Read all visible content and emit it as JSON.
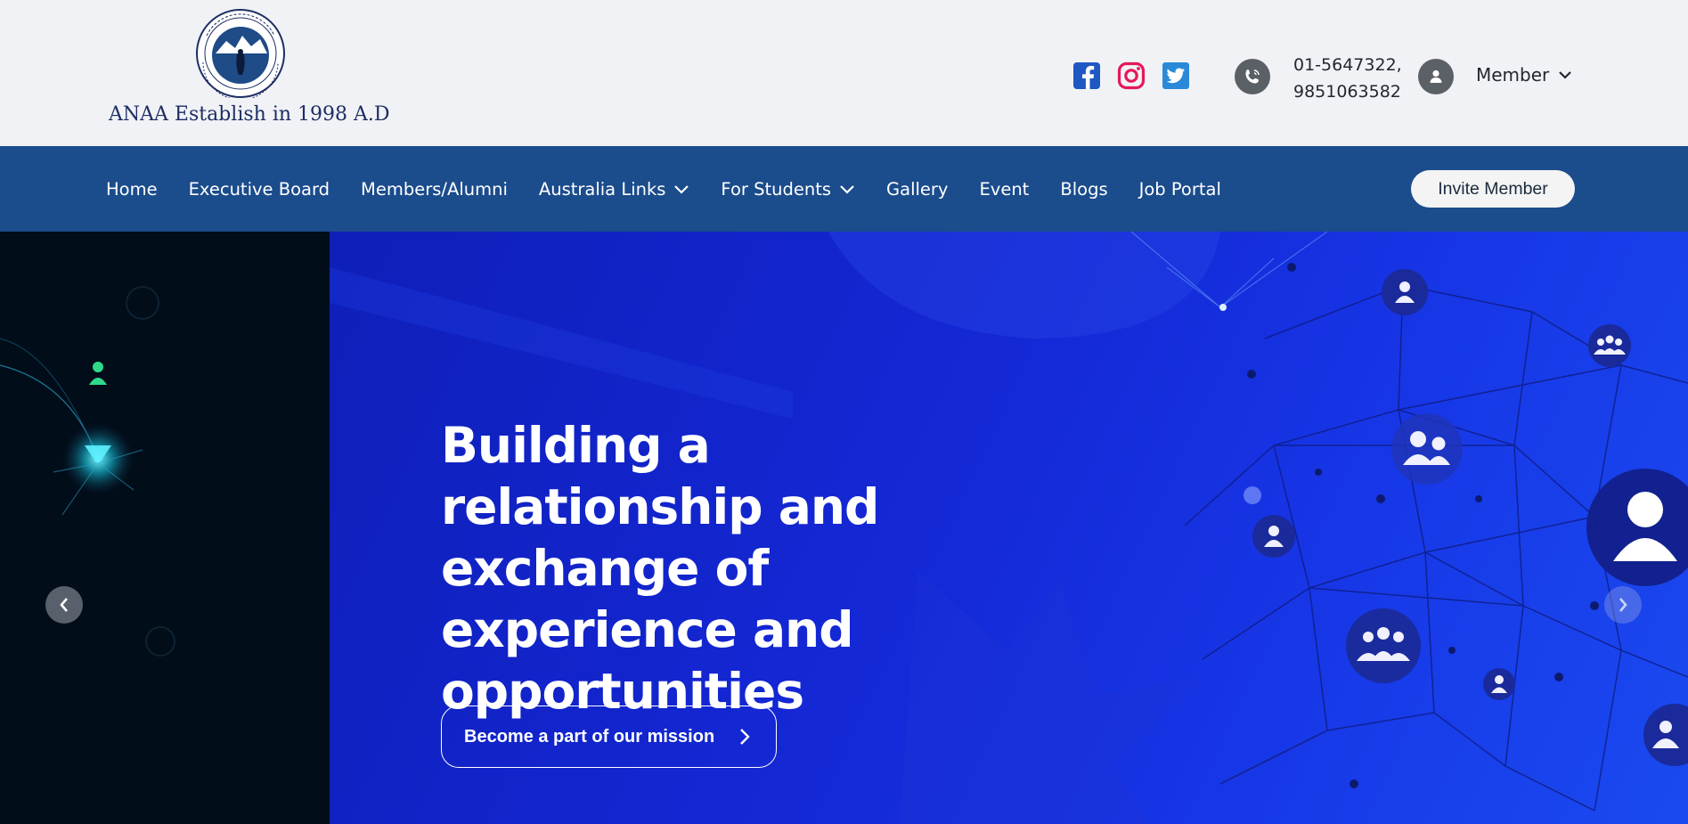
{
  "header": {
    "logo_text": "ANAA Establish in 1998 A.D",
    "social": [
      {
        "icon": "facebook-icon",
        "color": "#1f57c3"
      },
      {
        "icon": "instagram-icon",
        "color": "#e3195a"
      },
      {
        "icon": "twitter-icon",
        "color": "#2a8ad8"
      }
    ],
    "phone_line1": "01-5647322,",
    "phone_line2": "9851063582",
    "member_label": "Member"
  },
  "nav": {
    "items": [
      {
        "label": "Home",
        "has_dropdown": false
      },
      {
        "label": "Executive Board",
        "has_dropdown": false
      },
      {
        "label": "Members/Alumni",
        "has_dropdown": false
      },
      {
        "label": "Australia Links",
        "has_dropdown": true
      },
      {
        "label": "For Students",
        "has_dropdown": true
      },
      {
        "label": "Gallery",
        "has_dropdown": false
      },
      {
        "label": "Event",
        "has_dropdown": false
      },
      {
        "label": "Blogs",
        "has_dropdown": false
      },
      {
        "label": "Job Portal",
        "has_dropdown": false
      }
    ],
    "invite_label": "Invite Member"
  },
  "hero": {
    "title": "Building a relationship and exchange of experience and opportunities",
    "cta_label": "Become a part of our mission"
  },
  "colors": {
    "nav_bg": "#1b4c8c",
    "topbar_bg": "#f1f2f6",
    "hero_blue": "#1428d6"
  }
}
